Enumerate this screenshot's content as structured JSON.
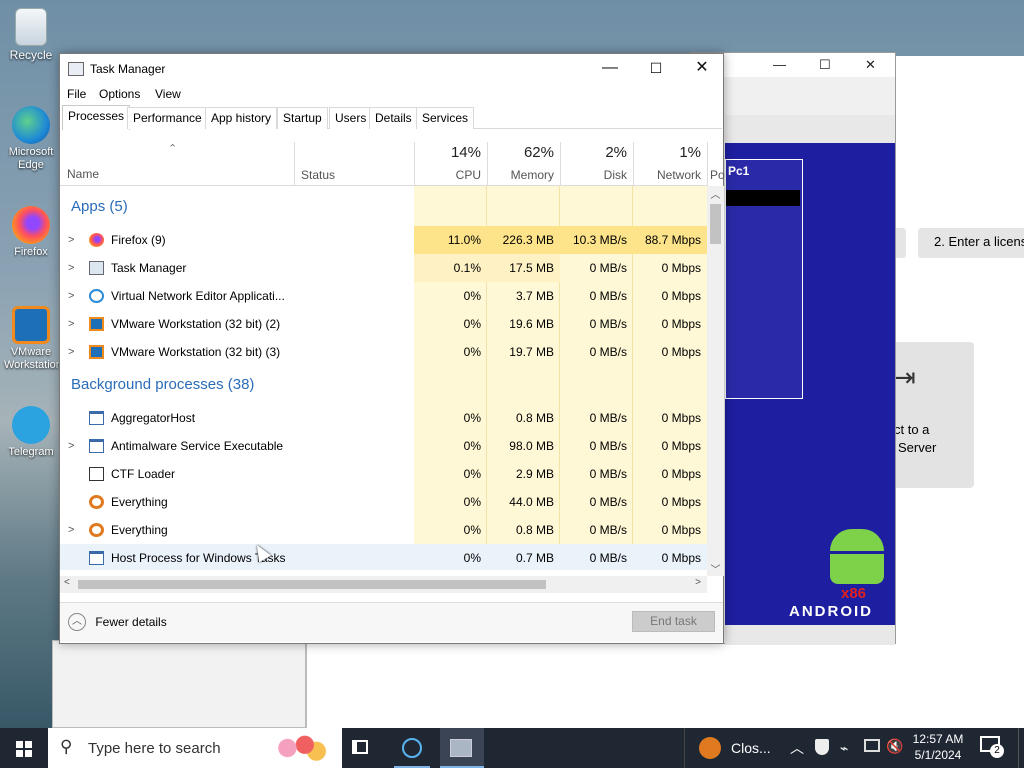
{
  "desktop": {
    "icons": [
      {
        "label": "Recycle",
        "icon": "recycle-bin-icon",
        "color": "#dfe8f0"
      },
      {
        "label": "Microsoft Edge",
        "icon": "edge-icon",
        "color": "#1e8ad6"
      },
      {
        "label": "Firefox",
        "icon": "firefox-icon",
        "color": "#ff7a1a"
      },
      {
        "label": "VMware Workstation",
        "icon": "vmware-icon",
        "color": "#f08a1c"
      },
      {
        "label": "Telegram",
        "icon": "telegram-icon",
        "color": "#2aa3e0"
      }
    ]
  },
  "bg_window": {
    "license_label": "2. Enter a licens",
    "connect_text": "ct to a",
    "connect_text2": "Server",
    "vm_label": "Pc1",
    "android_label": "ANDROID",
    "android_arch": "x86"
  },
  "task_manager": {
    "title": "Task Manager",
    "menu": [
      "File",
      "Options",
      "View"
    ],
    "tabs": [
      "Processes",
      "Performance",
      "App history",
      "Startup",
      "Users",
      "Details",
      "Services"
    ],
    "active_tab": "Processes",
    "columns": {
      "name": "Name",
      "status": "Status",
      "cpu": {
        "pct": "14%",
        "label": "CPU"
      },
      "memory": {
        "pct": "62%",
        "label": "Memory"
      },
      "disk": {
        "pct": "2%",
        "label": "Disk"
      },
      "network": {
        "pct": "1%",
        "label": "Network"
      },
      "power": "Po"
    },
    "apps_header": "Apps (5)",
    "apps": [
      {
        "name": "Firefox (9)",
        "icon": "firefox-icon",
        "expandable": true,
        "cpu": "11.0%",
        "memory": "226.3 MB",
        "disk": "10.3 MB/s",
        "network": "88.7 Mbps"
      },
      {
        "name": "Task Manager",
        "icon": "task-manager-icon",
        "expandable": true,
        "cpu": "0.1%",
        "memory": "17.5 MB",
        "disk": "0 MB/s",
        "network": "0 Mbps"
      },
      {
        "name": "Virtual Network Editor Applicati...",
        "icon": "globe-icon",
        "expandable": true,
        "cpu": "0%",
        "memory": "3.7 MB",
        "disk": "0 MB/s",
        "network": "0 Mbps"
      },
      {
        "name": "VMware Workstation (32 bit) (2)",
        "icon": "vmware-icon",
        "expandable": true,
        "cpu": "0%",
        "memory": "19.6 MB",
        "disk": "0 MB/s",
        "network": "0 Mbps"
      },
      {
        "name": "VMware Workstation (32 bit) (3)",
        "icon": "vmware-icon",
        "expandable": true,
        "cpu": "0%",
        "memory": "19.7 MB",
        "disk": "0 MB/s",
        "network": "0 Mbps"
      }
    ],
    "bg_header": "Background processes (38)",
    "background": [
      {
        "name": "AggregatorHost",
        "icon": "window-icon",
        "expandable": false,
        "cpu": "0%",
        "memory": "0.8 MB",
        "disk": "0 MB/s",
        "network": "0 Mbps"
      },
      {
        "name": "Antimalware Service Executable",
        "icon": "window-icon",
        "expandable": true,
        "cpu": "0%",
        "memory": "98.0 MB",
        "disk": "0 MB/s",
        "network": "0 Mbps"
      },
      {
        "name": "CTF Loader",
        "icon": "ctf-icon",
        "expandable": false,
        "cpu": "0%",
        "memory": "2.9 MB",
        "disk": "0 MB/s",
        "network": "0 Mbps"
      },
      {
        "name": "Everything",
        "icon": "everything-search-icon",
        "expandable": false,
        "cpu": "0%",
        "memory": "44.0 MB",
        "disk": "0 MB/s",
        "network": "0 Mbps"
      },
      {
        "name": "Everything",
        "icon": "everything-search-icon",
        "expandable": true,
        "cpu": "0%",
        "memory": "0.8 MB",
        "disk": "0 MB/s",
        "network": "0 Mbps"
      },
      {
        "name": "Host Process for Windows Tasks",
        "icon": "window-icon",
        "expandable": false,
        "cpu": "0%",
        "memory": "0.7 MB",
        "disk": "0 MB/s",
        "network": "0 Mbps"
      }
    ],
    "fewer_details": "Fewer details",
    "end_task": "End task"
  },
  "taskbar": {
    "search_placeholder": "Type here to search",
    "notification_app": "Clos...",
    "time": "12:57 AM",
    "date": "5/1/2024",
    "notification_count": "2"
  },
  "colors": {
    "cpu_high": "#fde48a",
    "cpu_mid": "#fef1c4",
    "cell_light": "#fff4c4",
    "group_blue": "#2a6cb8",
    "taskbar": "#1f2733"
  }
}
